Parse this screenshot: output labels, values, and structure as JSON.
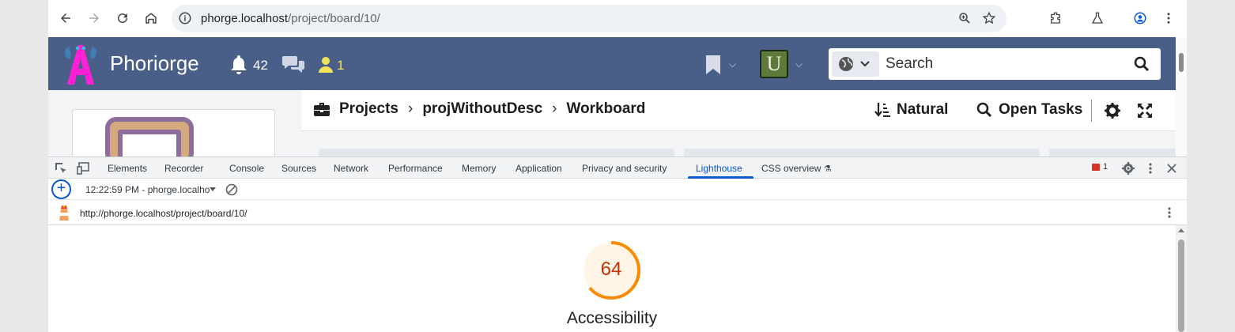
{
  "browser": {
    "url_host": "phorge.localhost",
    "url_path": "/project/board/10/"
  },
  "header": {
    "brand": "Phoriorge",
    "notifications_count": "42",
    "user_count": "1",
    "avatar_letter": "U",
    "search_placeholder": "Search",
    "colors": {
      "header_bg": "#4a5f88",
      "user_accent": "#f2e35c"
    }
  },
  "breadcrumb": {
    "items": [
      "Projects",
      "projWithoutDesc",
      "Workboard"
    ],
    "sort_label": "Natural",
    "filter_label": "Open Tasks"
  },
  "devtools": {
    "tabs": [
      "Elements",
      "Recorder",
      "Console",
      "Sources",
      "Network",
      "Performance",
      "Memory",
      "Application",
      "Privacy and security",
      "Lighthouse",
      "CSS overview"
    ],
    "active_tab": "Lighthouse",
    "issues_count": "1",
    "report_selector": "12:22:59 PM - phorge.localho",
    "report_url": "http://phorge.localhost/project/board/10/"
  },
  "lighthouse": {
    "category": "Accessibility",
    "score": "64",
    "score_fraction": 0.64,
    "score_color": "#fa8b00"
  }
}
